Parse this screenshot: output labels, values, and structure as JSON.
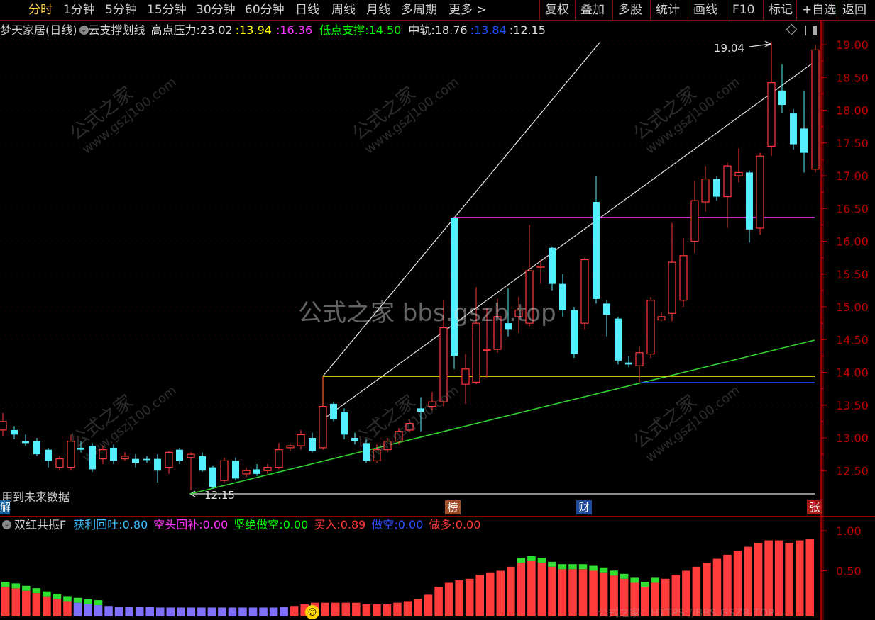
{
  "toolbar": {
    "period_tabs": [
      "分时",
      "1分钟",
      "5分钟",
      "15分钟",
      "30分钟",
      "60分钟",
      "日线",
      "周线",
      "月线",
      "多周期",
      "更多 >"
    ],
    "right_tabs": [
      "复权",
      "叠加",
      "多股",
      "统计",
      "画线",
      "F10",
      "标记",
      "+自选",
      "返回"
    ],
    "active_tab": "分时"
  },
  "main_info": {
    "stock_name": "梦天家居(日线)",
    "indicator_name": "云支撑划线",
    "high_label": "高点压力:",
    "high_v1": "23.02",
    "high_v2": ":13.94",
    "high_v3": ":16.36",
    "low_label": "低点支撑:",
    "low_v": "14.50",
    "mid_label": "中轨:",
    "mid_v1": "18.76",
    "mid_v2": ":13.84",
    "mid_v3": ":12.15"
  },
  "price_axis": [
    "19.00",
    "18.50",
    "18.00",
    "17.50",
    "17.00",
    "16.50",
    "16.00",
    "15.50",
    "15.00",
    "14.50",
    "14.00",
    "13.50",
    "13.00",
    "12.50"
  ],
  "annotations": {
    "high_point": "19.04",
    "low_point": "12.15",
    "future_data": "用到未来数据",
    "tag_left": "解",
    "tag_bang": "榜",
    "tag_cai": "财",
    "tag_zhang": "张"
  },
  "watermark": {
    "center_text": "公式之家 bbs.gszb.top",
    "small_cn": "公式之家",
    "small_url": "www.gszj100.com",
    "bottom_text": "公式之家：HTTPS://BBS.GSZB.TOP"
  },
  "indicator_info": {
    "name": "双红共振F",
    "l1": "获利回吐:",
    "v1": "0.80",
    "l2": "空头回补:",
    "v2": "0.00",
    "l3": "坚绝做空:",
    "v3": "0.00",
    "l4": "买入:",
    "v4": "0.89",
    "l5": "做空:",
    "v5": "0.00",
    "l6": "做多:",
    "v6": "0.00"
  },
  "indicator_axis": [
    "1.00",
    "0.50"
  ],
  "colors": {
    "up": "#ff3b3b",
    "down": "#54f0ff",
    "yellow": "#ffff00",
    "magenta": "#ff33ff",
    "green": "#00ff00",
    "blue": "#0000ff",
    "axis_red": "#c00000"
  }
}
